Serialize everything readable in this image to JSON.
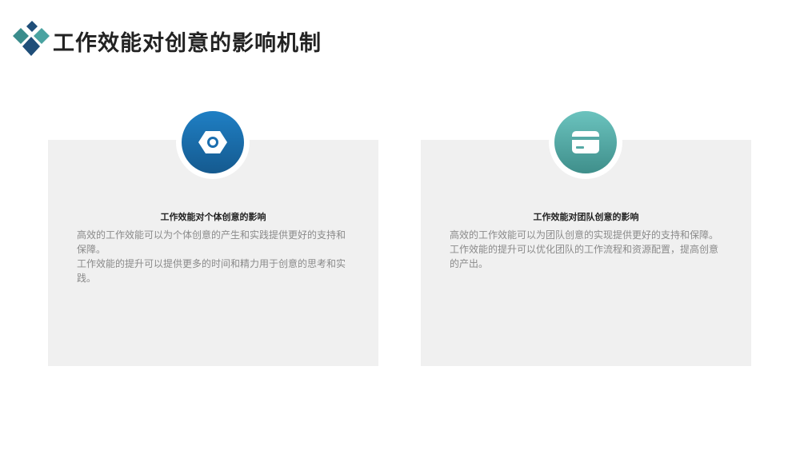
{
  "header": {
    "title": "工作效能对创意的影响机制",
    "logo_icon": "diamond-cluster-icon",
    "logo_colors": [
      "#2c7a7b",
      "#1f4e79",
      "#4aa3a1"
    ]
  },
  "cards": [
    {
      "icon": "hexagon-nut-icon",
      "accent": "#1a6eaf",
      "title": "工作效能对个体创意的影响",
      "paragraphs": [
        "高效的工作效能可以为个体创意的产生和实践提供更好的支持和保障。",
        "工作效能的提升可以提供更多的时间和精力用于创意的思考和实践。"
      ]
    },
    {
      "icon": "card-window-icon",
      "accent": "#55a9a5",
      "title": "工作效能对团队创意的影响",
      "paragraphs": [
        "高效的工作效能可以为团队创意的实现提供更好的支持和保障。",
        "工作效能的提升可以优化团队的工作流程和资源配置，提高创意的产出。"
      ]
    }
  ]
}
